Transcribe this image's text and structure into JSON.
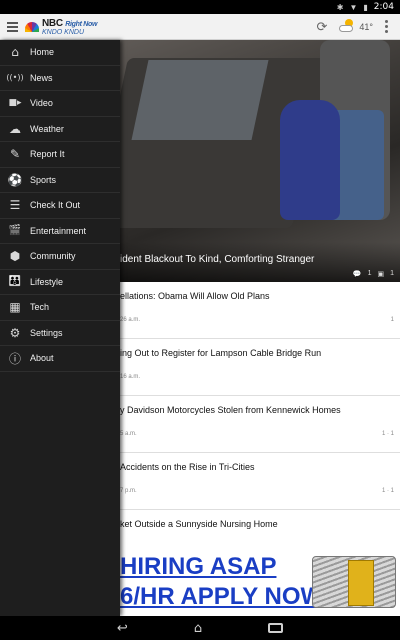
{
  "status_bar": {
    "time": "2:04",
    "icons": [
      "bluetooth-icon",
      "wifi-icon",
      "battery-icon"
    ]
  },
  "action_bar": {
    "brand": "NBC",
    "brand_sub": "Right Now",
    "brand_tag": "KNDO KNDU",
    "weather": {
      "temp": "41°",
      "icon": "partly-cloudy-icon"
    }
  },
  "drawer": {
    "items": [
      {
        "label": "Home",
        "icon": "⌂",
        "icon_name": "home-icon"
      },
      {
        "label": "News",
        "icon": "((•))",
        "icon_name": "broadcast-icon"
      },
      {
        "label": "Video",
        "icon": "■▸",
        "icon_name": "video-camera-icon"
      },
      {
        "label": "Weather",
        "icon": "☁",
        "icon_name": "weather-icon"
      },
      {
        "label": "Report It",
        "icon": "✎",
        "icon_name": "pencil-icon"
      },
      {
        "label": "Sports",
        "icon": "⚽",
        "icon_name": "sports-ball-icon"
      },
      {
        "label": "Check It Out",
        "icon": "☰",
        "icon_name": "list-icon"
      },
      {
        "label": "Entertainment",
        "icon": "🎬",
        "icon_name": "clapperboard-icon"
      },
      {
        "label": "Community",
        "icon": "⬢",
        "icon_name": "cube-icon"
      },
      {
        "label": "Lifestyle",
        "icon": "👪",
        "icon_name": "family-icon"
      },
      {
        "label": "Tech",
        "icon": "▦",
        "icon_name": "briefcase-icon"
      },
      {
        "label": "Settings",
        "icon": "⚙",
        "icon_name": "gear-icon"
      },
      {
        "label": "About",
        "icon": "ⓘ",
        "icon_name": "info-icon"
      }
    ]
  },
  "hero": {
    "caption": "ident Blackout To Kind, Comforting Stranger",
    "comments": "1",
    "photos": "1"
  },
  "stories": [
    {
      "title": "ellations: Obama Will Allow Old Plans",
      "time": "26 a.m.",
      "meta": "1"
    },
    {
      "title": "ing Out to Register for Lampson Cable Bridge Run",
      "time": "16 a.m.",
      "meta": ""
    },
    {
      "title": "y Davidson Motorcycles Stolen from Kennewick Homes",
      "time": "5 a.m.",
      "meta": "1  ·  1"
    },
    {
      "title": "Accidents on the Rise in Tri-Cities",
      "time": "7 p.m.",
      "meta": "1  ·  1"
    },
    {
      "title": "ket Outside a Sunnyside Nursing Home",
      "time": "",
      "meta": ""
    }
  ],
  "ad": {
    "line1": "HIRING ASAP",
    "line2": "6/HR APPLY NOW"
  },
  "nav": {
    "back": "↩",
    "home": "⌂"
  }
}
